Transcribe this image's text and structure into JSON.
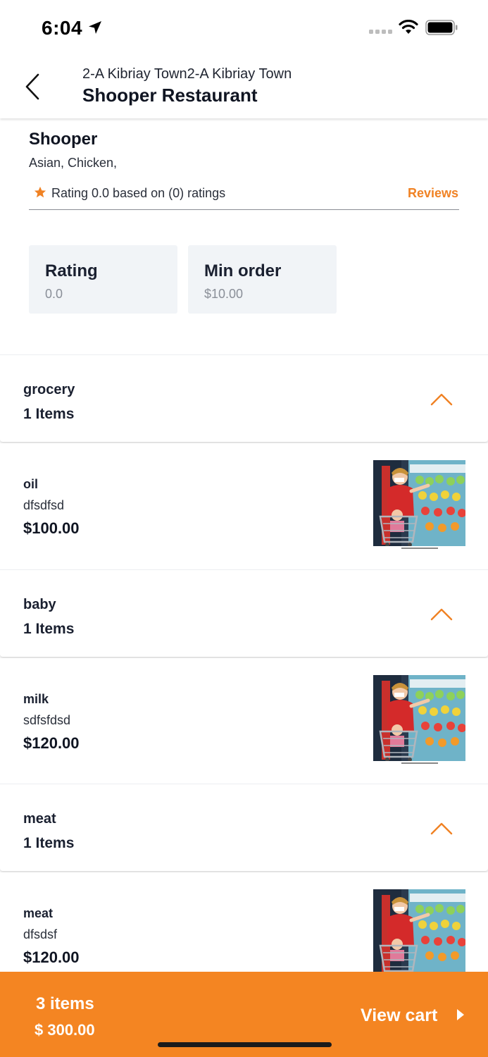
{
  "status_bar": {
    "time": "6:04",
    "icons": [
      "location-arrow-icon",
      "cellular-signal-icon",
      "wifi-icon",
      "battery-icon"
    ]
  },
  "header": {
    "subtitle": "2-A Kibriay Town2-A Kibriay Town",
    "title": "Shooper Restaurant",
    "back_icon": "chevron-left-icon"
  },
  "store": {
    "name": "Shooper",
    "cuisine": "Asian, Chicken,",
    "rating_text": "Rating 0.0 based on (0) ratings",
    "reviews_label": "Reviews",
    "stats": [
      {
        "label": "Rating",
        "value": "0.0"
      },
      {
        "label": "Min order",
        "value": "$10.00"
      }
    ]
  },
  "categories": [
    {
      "name": "grocery",
      "count": "1 Items",
      "items": [
        {
          "name": "oil",
          "description": "dfsdfsd",
          "price": "$100.00"
        }
      ]
    },
    {
      "name": "baby",
      "count": "1 Items",
      "items": [
        {
          "name": "milk",
          "description": "sdfsfdsd",
          "price": "$120.00"
        }
      ]
    },
    {
      "name": "meat",
      "count": "1 Items",
      "items": [
        {
          "name": "meat",
          "description": "dfsdsf",
          "price": "$120.00"
        }
      ]
    }
  ],
  "cart": {
    "count": "3 items",
    "total": "$ 300.00",
    "view_label": "View cart"
  },
  "colors": {
    "accent": "#f48522",
    "stat_card_bg": "#f1f4f7",
    "text_dark": "#1a2030"
  }
}
